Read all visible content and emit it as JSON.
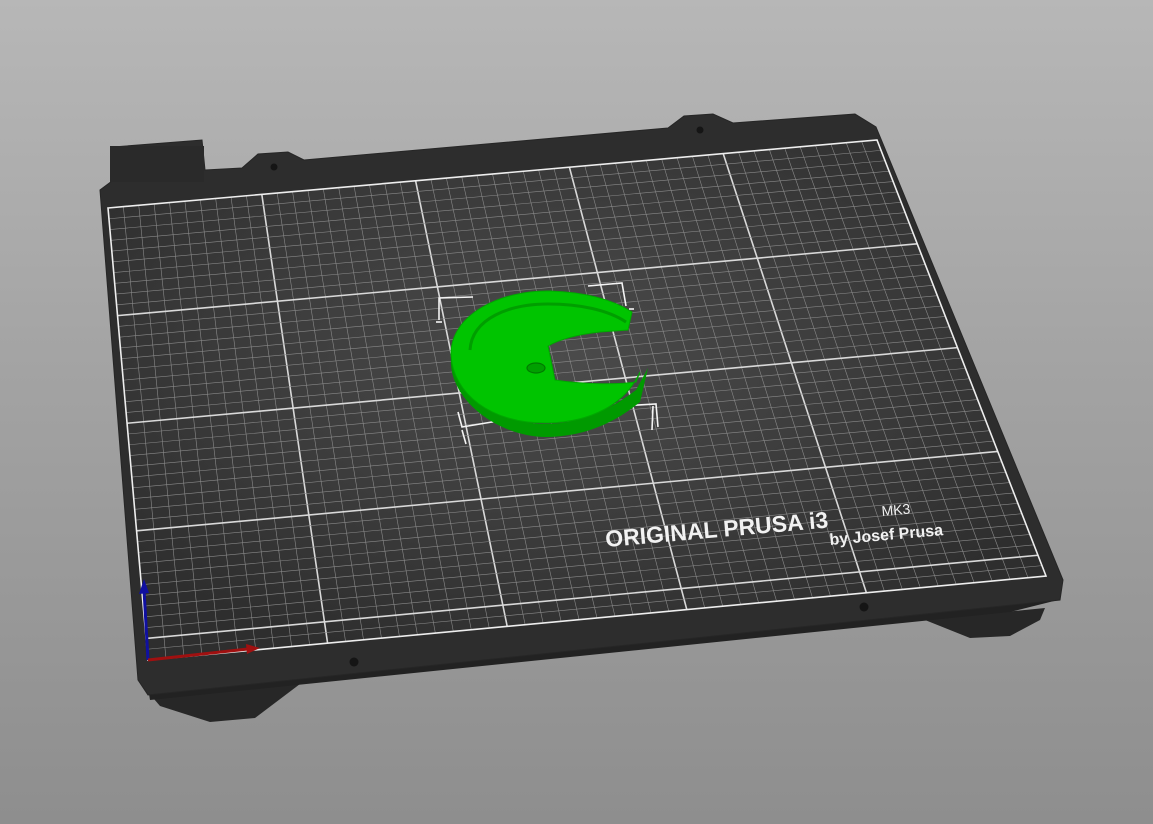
{
  "app": {
    "view": "3D plater view"
  },
  "bed": {
    "brand_line1": "ORIGINAL PRUSA i3",
    "brand_model": "MK3",
    "brand_line2": "by Josef Prusa",
    "colors": {
      "plate": "#2d2d2d",
      "plate_edge": "#262626",
      "grid_fine": "#8a8a8a",
      "grid_major": "#d9d9d9",
      "border": "#eeeeee"
    }
  },
  "object": {
    "color": "#00c400",
    "shadow_color": "#009a00",
    "selected": true
  },
  "axes": {
    "x_color": "#a01010",
    "y_color": "#1010a0"
  }
}
